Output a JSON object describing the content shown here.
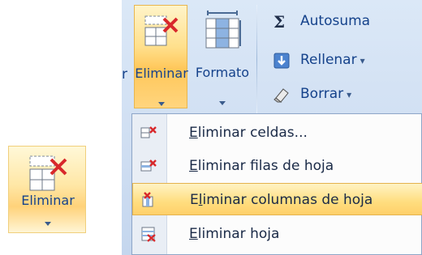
{
  "mini_tile": {
    "label": "Eliminar",
    "icon": "delete-cells-icon"
  },
  "ribbon": {
    "cut_label": "r",
    "eliminar": {
      "label": "Eliminar",
      "icon": "delete-cells-icon"
    },
    "formato": {
      "label": "Formato",
      "icon": "format-icon"
    },
    "small_buttons": [
      {
        "label": "Autosuma",
        "icon": "sigma-icon",
        "caret": ""
      },
      {
        "label": "Rellenar",
        "icon": "fill-down-icon",
        "caret": "▾"
      },
      {
        "label": "Borrar",
        "icon": "eraser-icon",
        "caret": "▾"
      }
    ]
  },
  "menu": {
    "items": [
      {
        "label_accel": "E",
        "label_rest": "liminar celdas...",
        "icon": "delete-cells-icon",
        "highlighted": false
      },
      {
        "label_accel": "E",
        "label_rest": "liminar filas de hoja",
        "icon": "delete-rows-icon",
        "highlighted": false
      },
      {
        "label_pre": "E",
        "label_accel": "l",
        "label_rest": "iminar columnas de hoja",
        "icon": "delete-columns-icon",
        "highlighted": true
      },
      {
        "label_accel": "E",
        "label_rest": "liminar hoja",
        "icon": "delete-sheet-icon",
        "highlighted": false
      }
    ]
  },
  "colors": {
    "ribbon_blue": "#15428b",
    "highlight_gold": "#ffd06a",
    "delete_red": "#d8282b"
  }
}
